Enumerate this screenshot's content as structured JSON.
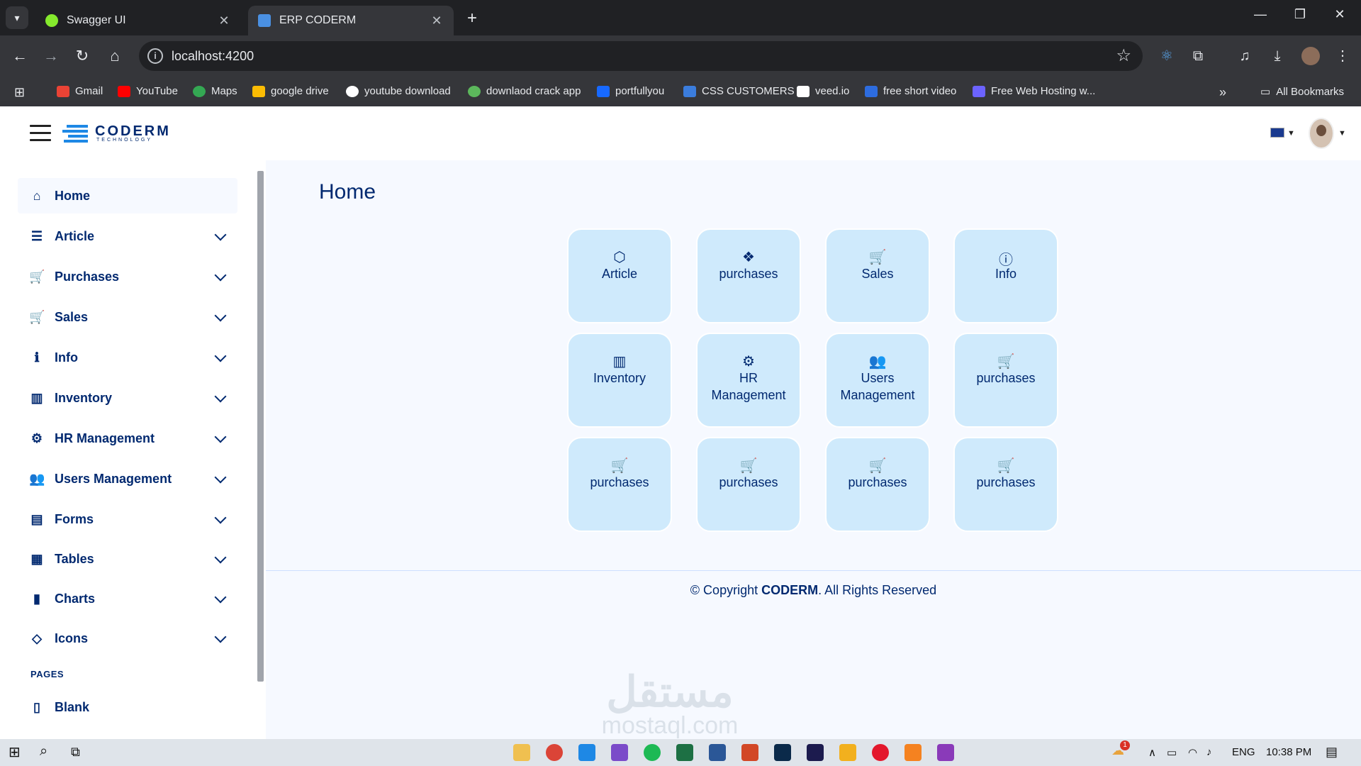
{
  "browser": {
    "tabs": [
      {
        "title": "Swagger UI",
        "favicon_color": "#85ea2d"
      },
      {
        "title": "ERP CODERM",
        "favicon_color": "#4a90e2"
      }
    ],
    "url": "localhost:4200",
    "bookmarks": [
      {
        "label": "Gmail",
        "color": "#ea4335"
      },
      {
        "label": "YouTube",
        "color": "#ff0000"
      },
      {
        "label": "Maps",
        "color": "#34a853"
      },
      {
        "label": "google drive",
        "color": "#fbbc04"
      },
      {
        "label": "youtube download",
        "color": "#ffffff"
      },
      {
        "label": "downlaod crack app",
        "color": "#5cb85c"
      },
      {
        "label": "portfullyou",
        "color": "#1769ff"
      },
      {
        "label": "CSS CUSTOMERS",
        "color": "#3b7ddd"
      },
      {
        "label": "veed.io",
        "color": "#ffffff"
      },
      {
        "label": "free short video",
        "color": "#2d6cdf"
      },
      {
        "label": "Free Web Hosting w...",
        "color": "#6c63ff"
      }
    ],
    "all_bookmarks": "All Bookmarks"
  },
  "app": {
    "brand": "CODERM",
    "brand_sub": "TECHNOLOGY"
  },
  "sidebar": {
    "items": [
      {
        "label": "Home",
        "icon": "house-icon",
        "glyph": "⌂"
      },
      {
        "label": "Article",
        "icon": "layers-icon",
        "glyph": "☰"
      },
      {
        "label": "Purchases",
        "icon": "cart-check-icon",
        "glyph": "🛒"
      },
      {
        "label": "Sales",
        "icon": "cart-icon",
        "glyph": "🛒"
      },
      {
        "label": "Info",
        "icon": "info-circle-icon",
        "glyph": "ℹ"
      },
      {
        "label": "Inventory",
        "icon": "building-icon",
        "glyph": "▥"
      },
      {
        "label": "HR Management",
        "icon": "gear-people-icon",
        "glyph": "⚙"
      },
      {
        "label": "Users Management",
        "icon": "people-icon",
        "glyph": "👥"
      },
      {
        "label": "Forms",
        "icon": "journal-icon",
        "glyph": "▤"
      },
      {
        "label": "Tables",
        "icon": "table-icon",
        "glyph": "▦"
      },
      {
        "label": "Charts",
        "icon": "bar-chart-icon",
        "glyph": "▮"
      },
      {
        "label": "Icons",
        "icon": "gem-icon",
        "glyph": "◇"
      }
    ],
    "pages_heading": "PAGES",
    "pages": [
      {
        "label": "Blank",
        "icon": "file-icon",
        "glyph": "▯"
      }
    ]
  },
  "main": {
    "title": "Home",
    "tiles": [
      {
        "label": "Article",
        "icon": "box-icon",
        "glyph": "⬡"
      },
      {
        "label": "purchases",
        "icon": "boxes-icon",
        "glyph": "❖"
      },
      {
        "label": "Sales",
        "icon": "cart-icon",
        "glyph": "🛒"
      },
      {
        "label": "Info",
        "icon": "info-circle-icon",
        "glyph": "ⓘ"
      },
      {
        "label": "Inventory",
        "icon": "building-icon",
        "glyph": "▥"
      },
      {
        "label": "HR\nManagement",
        "icon": "gear-people-icon",
        "glyph": "⚙"
      },
      {
        "label": "Users\nManagement",
        "icon": "people-icon",
        "glyph": "👥"
      },
      {
        "label": "purchases",
        "icon": "cart-fill-icon",
        "glyph": "🛒"
      },
      {
        "label": "purchases",
        "icon": "cart-fill-icon",
        "glyph": "🛒"
      },
      {
        "label": "purchases",
        "icon": "cart-fill-icon",
        "glyph": "🛒"
      },
      {
        "label": "purchases",
        "icon": "cart-fill-icon",
        "glyph": "🛒"
      },
      {
        "label": "purchases",
        "icon": "cart-fill-icon",
        "glyph": "🛒"
      }
    ],
    "footer": {
      "prefix": "© Copyright ",
      "brand": "CODERM",
      "suffix": ". All Rights Reserved"
    },
    "watermark": {
      "arabic": "مستقل",
      "latin": "mostaql.com"
    }
  },
  "taskbar": {
    "language": "ENG",
    "time": "10:38 PM",
    "notification_badge": "1"
  }
}
